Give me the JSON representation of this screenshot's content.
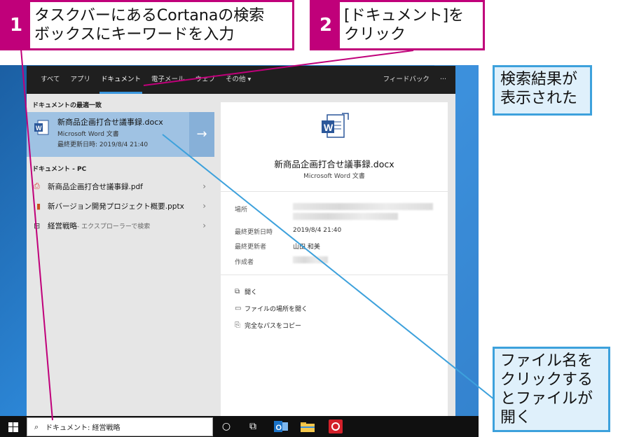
{
  "callouts": {
    "step1": {
      "num": "1",
      "line1": "タスクバーにあるCortanaの検索",
      "line2": "ボックスにキーワードを入力"
    },
    "step2": {
      "num": "2",
      "line1": "[ドキュメント]を",
      "line2": "クリック"
    },
    "result": {
      "line1": "検索結果が",
      "line2": "表示された"
    },
    "open": {
      "line1": "ファイル名を",
      "line2": "クリックする",
      "line3": "とファイルが",
      "line4": "開く"
    }
  },
  "search": {
    "tabs": [
      "すべて",
      "アプリ",
      "ドキュメント",
      "電子メール",
      "ウェブ",
      "その他 ▾"
    ],
    "feedback": "フィードバック",
    "more": "···",
    "best_match_header": "ドキュメントの最適一致",
    "best_match": {
      "title": "新商品企画打合せ議事録.docx",
      "type": "Microsoft Word 文書",
      "modified": "最終更新日時: 2019/8/4 21:40"
    },
    "pc_header": "ドキュメント - PC",
    "results": [
      {
        "name": "新商品企画打合せ議事録.pdf",
        "icon": "pdf-icon"
      },
      {
        "name": "新バージョン開発プロジェクト概要.pptx",
        "icon": "pptx-icon"
      },
      {
        "name": "経営戦略",
        "suffix": " - エクスプローラーで検索",
        "icon": "folder-search-icon"
      }
    ],
    "preview": {
      "title": "新商品企画打合せ議事録.docx",
      "type": "Microsoft Word 文書",
      "labels": {
        "location": "場所",
        "modified": "最終更新日時",
        "modified_by": "最終更新者",
        "author": "作成者"
      },
      "values": {
        "modified": "2019/8/4 21:40",
        "modified_by": "山田 和美"
      },
      "actions": [
        "開く",
        "ファイルの場所を開く",
        "完全なパスをコピー"
      ]
    },
    "query": "ドキュメント: 経営戦略"
  },
  "colors": {
    "accent": "#c0007a",
    "callout_blue": "#3da1dc",
    "selection": "#9fc2e3"
  }
}
